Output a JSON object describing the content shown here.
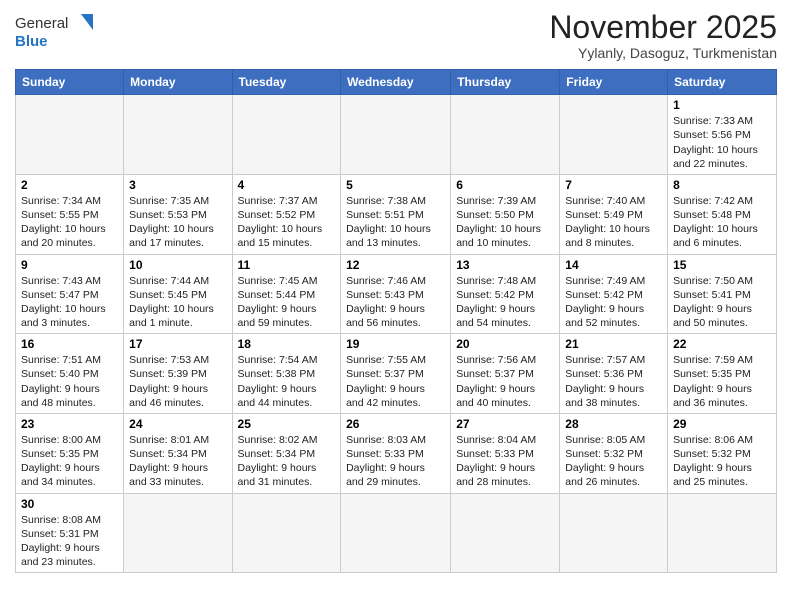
{
  "header": {
    "logo_general": "General",
    "logo_blue": "Blue",
    "title": "November 2025",
    "subtitle": "Yylanly, Dasoguz, Turkmenistan"
  },
  "weekdays": [
    "Sunday",
    "Monday",
    "Tuesday",
    "Wednesday",
    "Thursday",
    "Friday",
    "Saturday"
  ],
  "weeks": [
    [
      {
        "day": "",
        "info": ""
      },
      {
        "day": "",
        "info": ""
      },
      {
        "day": "",
        "info": ""
      },
      {
        "day": "",
        "info": ""
      },
      {
        "day": "",
        "info": ""
      },
      {
        "day": "",
        "info": ""
      },
      {
        "day": "1",
        "info": "Sunrise: 7:33 AM\nSunset: 5:56 PM\nDaylight: 10 hours\nand 22 minutes."
      }
    ],
    [
      {
        "day": "2",
        "info": "Sunrise: 7:34 AM\nSunset: 5:55 PM\nDaylight: 10 hours\nand 20 minutes."
      },
      {
        "day": "3",
        "info": "Sunrise: 7:35 AM\nSunset: 5:53 PM\nDaylight: 10 hours\nand 17 minutes."
      },
      {
        "day": "4",
        "info": "Sunrise: 7:37 AM\nSunset: 5:52 PM\nDaylight: 10 hours\nand 15 minutes."
      },
      {
        "day": "5",
        "info": "Sunrise: 7:38 AM\nSunset: 5:51 PM\nDaylight: 10 hours\nand 13 minutes."
      },
      {
        "day": "6",
        "info": "Sunrise: 7:39 AM\nSunset: 5:50 PM\nDaylight: 10 hours\nand 10 minutes."
      },
      {
        "day": "7",
        "info": "Sunrise: 7:40 AM\nSunset: 5:49 PM\nDaylight: 10 hours\nand 8 minutes."
      },
      {
        "day": "8",
        "info": "Sunrise: 7:42 AM\nSunset: 5:48 PM\nDaylight: 10 hours\nand 6 minutes."
      }
    ],
    [
      {
        "day": "9",
        "info": "Sunrise: 7:43 AM\nSunset: 5:47 PM\nDaylight: 10 hours\nand 3 minutes."
      },
      {
        "day": "10",
        "info": "Sunrise: 7:44 AM\nSunset: 5:45 PM\nDaylight: 10 hours\nand 1 minute."
      },
      {
        "day": "11",
        "info": "Sunrise: 7:45 AM\nSunset: 5:44 PM\nDaylight: 9 hours\nand 59 minutes."
      },
      {
        "day": "12",
        "info": "Sunrise: 7:46 AM\nSunset: 5:43 PM\nDaylight: 9 hours\nand 56 minutes."
      },
      {
        "day": "13",
        "info": "Sunrise: 7:48 AM\nSunset: 5:42 PM\nDaylight: 9 hours\nand 54 minutes."
      },
      {
        "day": "14",
        "info": "Sunrise: 7:49 AM\nSunset: 5:42 PM\nDaylight: 9 hours\nand 52 minutes."
      },
      {
        "day": "15",
        "info": "Sunrise: 7:50 AM\nSunset: 5:41 PM\nDaylight: 9 hours\nand 50 minutes."
      }
    ],
    [
      {
        "day": "16",
        "info": "Sunrise: 7:51 AM\nSunset: 5:40 PM\nDaylight: 9 hours\nand 48 minutes."
      },
      {
        "day": "17",
        "info": "Sunrise: 7:53 AM\nSunset: 5:39 PM\nDaylight: 9 hours\nand 46 minutes."
      },
      {
        "day": "18",
        "info": "Sunrise: 7:54 AM\nSunset: 5:38 PM\nDaylight: 9 hours\nand 44 minutes."
      },
      {
        "day": "19",
        "info": "Sunrise: 7:55 AM\nSunset: 5:37 PM\nDaylight: 9 hours\nand 42 minutes."
      },
      {
        "day": "20",
        "info": "Sunrise: 7:56 AM\nSunset: 5:37 PM\nDaylight: 9 hours\nand 40 minutes."
      },
      {
        "day": "21",
        "info": "Sunrise: 7:57 AM\nSunset: 5:36 PM\nDaylight: 9 hours\nand 38 minutes."
      },
      {
        "day": "22",
        "info": "Sunrise: 7:59 AM\nSunset: 5:35 PM\nDaylight: 9 hours\nand 36 minutes."
      }
    ],
    [
      {
        "day": "23",
        "info": "Sunrise: 8:00 AM\nSunset: 5:35 PM\nDaylight: 9 hours\nand 34 minutes."
      },
      {
        "day": "24",
        "info": "Sunrise: 8:01 AM\nSunset: 5:34 PM\nDaylight: 9 hours\nand 33 minutes."
      },
      {
        "day": "25",
        "info": "Sunrise: 8:02 AM\nSunset: 5:34 PM\nDaylight: 9 hours\nand 31 minutes."
      },
      {
        "day": "26",
        "info": "Sunrise: 8:03 AM\nSunset: 5:33 PM\nDaylight: 9 hours\nand 29 minutes."
      },
      {
        "day": "27",
        "info": "Sunrise: 8:04 AM\nSunset: 5:33 PM\nDaylight: 9 hours\nand 28 minutes."
      },
      {
        "day": "28",
        "info": "Sunrise: 8:05 AM\nSunset: 5:32 PM\nDaylight: 9 hours\nand 26 minutes."
      },
      {
        "day": "29",
        "info": "Sunrise: 8:06 AM\nSunset: 5:32 PM\nDaylight: 9 hours\nand 25 minutes."
      }
    ],
    [
      {
        "day": "30",
        "info": "Sunrise: 8:08 AM\nSunset: 5:31 PM\nDaylight: 9 hours\nand 23 minutes."
      },
      {
        "day": "",
        "info": ""
      },
      {
        "day": "",
        "info": ""
      },
      {
        "day": "",
        "info": ""
      },
      {
        "day": "",
        "info": ""
      },
      {
        "day": "",
        "info": ""
      },
      {
        "day": "",
        "info": ""
      }
    ]
  ]
}
